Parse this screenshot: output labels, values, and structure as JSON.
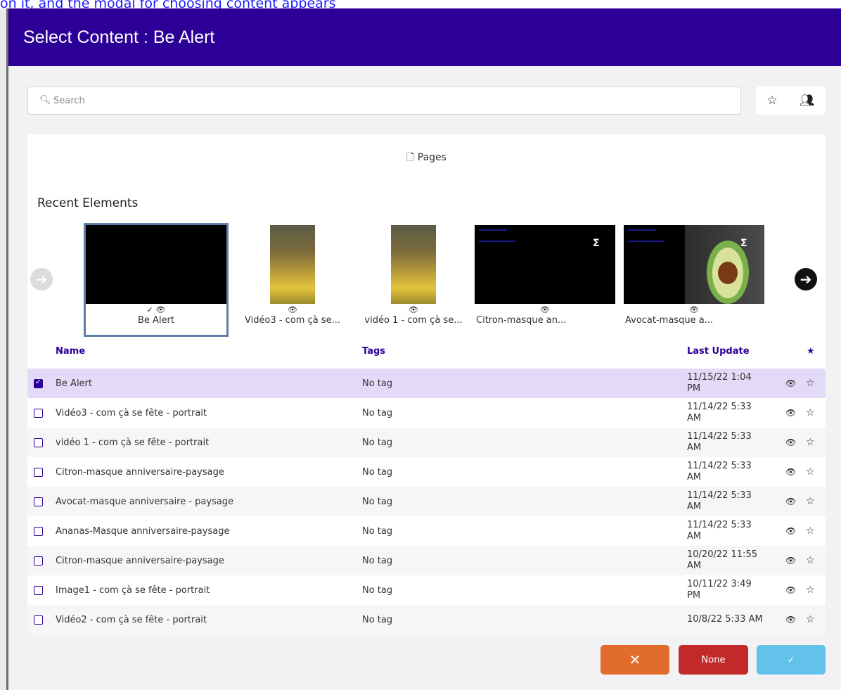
{
  "background": {
    "caption": "on it, and the modal for choosing content appears"
  },
  "modal": {
    "title": "Select Content : Be Alert"
  },
  "search": {
    "placeholder": "Search"
  },
  "icons": {
    "search": "magnifier-icon",
    "favorites_filter": "star-icon",
    "team_filter": "users-icon",
    "pages": "document-icon",
    "preview": "eye-icon",
    "selected": "check-icon"
  },
  "pages_tab": {
    "label": "Pages"
  },
  "recent": {
    "title": "Recent Elements",
    "items": [
      {
        "label": "Be Alert"
      },
      {
        "label": "Vidéo3 - com çà se..."
      },
      {
        "label": "vidéo 1 - com çà se..."
      },
      {
        "label": "Citron-masque an..."
      },
      {
        "label": "Avocat-masque a..."
      }
    ]
  },
  "table": {
    "headers": {
      "name": "Name",
      "tags": "Tags",
      "last_update": "Last Update",
      "star": "★"
    },
    "rows": [
      {
        "name": "Be Alert",
        "tag": "No tag",
        "date": "11/15/22 1:04 PM",
        "checked": true
      },
      {
        "name": "Vidéo3 - com çà se fête - portrait",
        "tag": "No tag",
        "date": "11/14/22 5:33 AM",
        "checked": false
      },
      {
        "name": "vidéo 1 - com çà se fête - portrait",
        "tag": "No tag",
        "date": "11/14/22 5:33 AM",
        "checked": false
      },
      {
        "name": "Citron-masque anniversaire-paysage",
        "tag": "No tag",
        "date": "11/14/22 5:33 AM",
        "checked": false
      },
      {
        "name": "Avocat-masque anniversaire - paysage",
        "tag": "No tag",
        "date": "11/14/22 5:33 AM",
        "checked": false
      },
      {
        "name": "Ananas-Masque anniversaire-paysage",
        "tag": "No tag",
        "date": "11/14/22 5:33 AM",
        "checked": false
      },
      {
        "name": "Citron-masque anniversaire-paysage",
        "tag": "No tag",
        "date": "10/20/22 11:55 AM",
        "checked": false
      },
      {
        "name": "Image1 - com çà se fête - portrait",
        "tag": "No tag",
        "date": "10/11/22 3:49 PM",
        "checked": false
      },
      {
        "name": "Vidéo2 - com çà se fête - portrait",
        "tag": "No tag",
        "date": "10/8/22 5:33 AM",
        "checked": false
      }
    ]
  },
  "footer": {
    "cancel_label": "✕",
    "none_label": "None",
    "confirm_label": "✓"
  },
  "colors": {
    "header": "#2c0096",
    "cancel": "#e26c2c",
    "none": "#c22a2a",
    "confirm": "#63c2ea",
    "selected_row": "#e3daf7"
  }
}
